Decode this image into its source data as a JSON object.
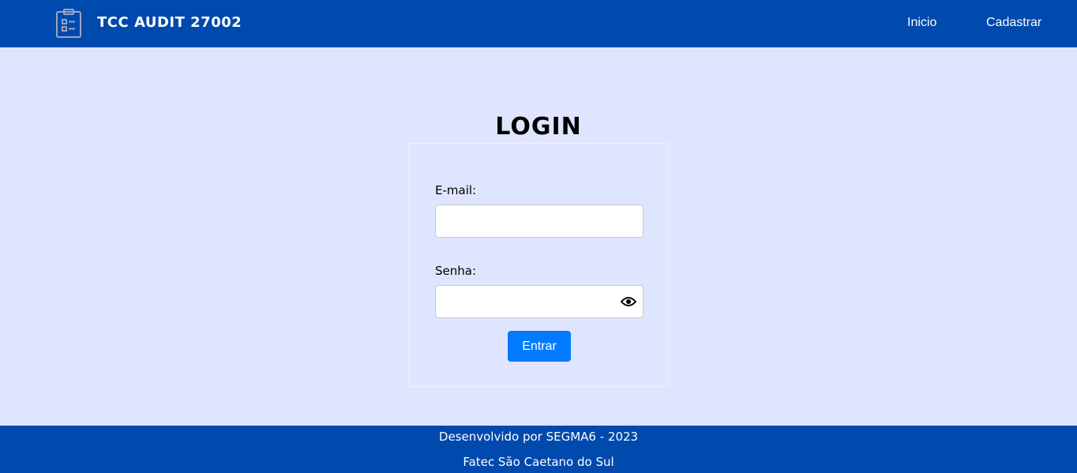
{
  "header": {
    "brand": "TCC AUDIT 27002",
    "logo_icon": "clipboard-list-icon",
    "nav": [
      {
        "label": "Inicio"
      },
      {
        "label": "Cadastrar"
      }
    ]
  },
  "login": {
    "title": "LOGIN",
    "email_label": "E-mail:",
    "email_value": "",
    "password_label": "Senha:",
    "password_value": "",
    "toggle_icon": "eye-icon",
    "submit_label": "Entrar"
  },
  "footer": {
    "line1": "Desenvolvido por SEGMA6 - 2023",
    "line2": "Fatec São Caetano do Sul"
  },
  "colors": {
    "header": "#0049ad",
    "background": "#e0e5ff",
    "button": "#007bff"
  }
}
